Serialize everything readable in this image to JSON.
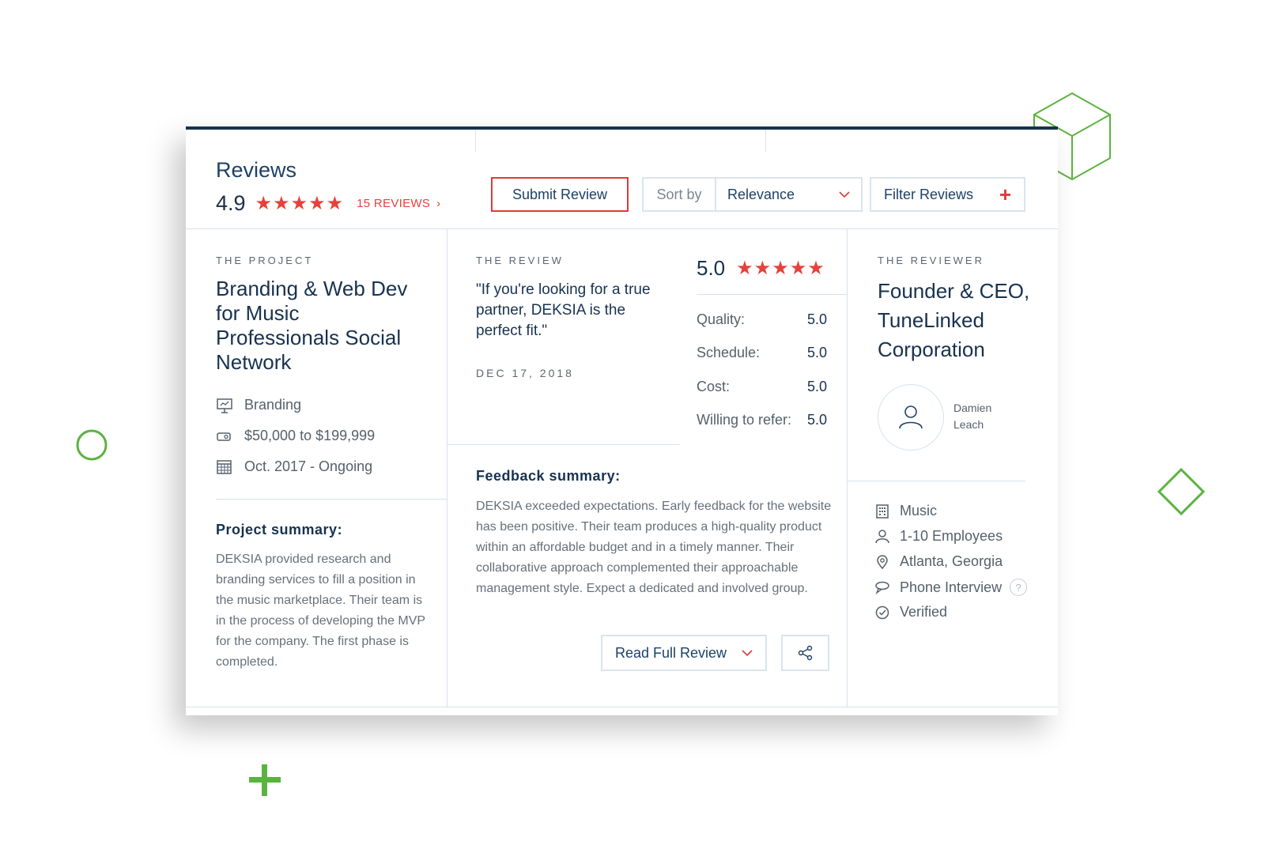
{
  "header": {
    "title": "Reviews",
    "rating": "4.9",
    "stars": "★★★★★",
    "reviews_link": "15 REVIEWS",
    "reviews_chevron": "›",
    "submit_label": "Submit Review",
    "sort_label": "Sort by",
    "sort_value": "Relevance",
    "filter_label": "Filter Reviews",
    "filter_plus": "+"
  },
  "project": {
    "eyebrow": "THE PROJECT",
    "title": "Branding & Web Dev for Music Professionals Social Network",
    "meta": [
      {
        "icon": "presentation-icon",
        "text": "Branding"
      },
      {
        "icon": "price-tag-icon",
        "text": "$50,000 to $199,999"
      },
      {
        "icon": "calendar-icon",
        "text": "Oct. 2017 - Ongoing"
      }
    ],
    "summary_heading": "Project summary:",
    "summary_text": "DEKSIA provided research and branding services to fill a position in the music marketplace. Their team is in the process of developing the MVP for the company. The first phase is completed."
  },
  "review": {
    "eyebrow": "THE REVIEW",
    "quote": "\"If you're looking for a true partner, DEKSIA is the perfect fit.\"",
    "date": "DEC 17, 2018",
    "score": "5.0",
    "stars": "★★★★★",
    "criteria": [
      {
        "label": "Quality:",
        "value": "5.0"
      },
      {
        "label": "Schedule:",
        "value": "5.0"
      },
      {
        "label": "Cost:",
        "value": "5.0"
      },
      {
        "label": "Willing to refer:",
        "value": "5.0"
      }
    ],
    "feedback_heading": "Feedback summary:",
    "feedback_text": "DEKSIA exceeded expectations. Early feedback for the website has been positive. Their team produces a high-quality product within an affordable budget and in a timely manner. Their collaborative approach complemented their approachable management style. Expect a dedicated and involved group.",
    "read_full_label": "Read Full Review"
  },
  "reviewer": {
    "eyebrow": "THE REVIEWER",
    "title": "Founder & CEO, TuneLinked Corporation",
    "name": "Damien Leach",
    "info": [
      {
        "icon": "building-icon",
        "text": "Music"
      },
      {
        "icon": "person-icon",
        "text": "1-10 Employees"
      },
      {
        "icon": "location-pin-icon",
        "text": "Atlanta, Georgia"
      },
      {
        "icon": "chat-bubble-icon",
        "text": "Phone Interview"
      },
      {
        "icon": "check-circle-icon",
        "text": "Verified"
      }
    ],
    "help_glyph": "?"
  },
  "colors": {
    "accent_red": "#e8403a",
    "navy": "#17324f",
    "deco_green": "#5bb33f"
  }
}
